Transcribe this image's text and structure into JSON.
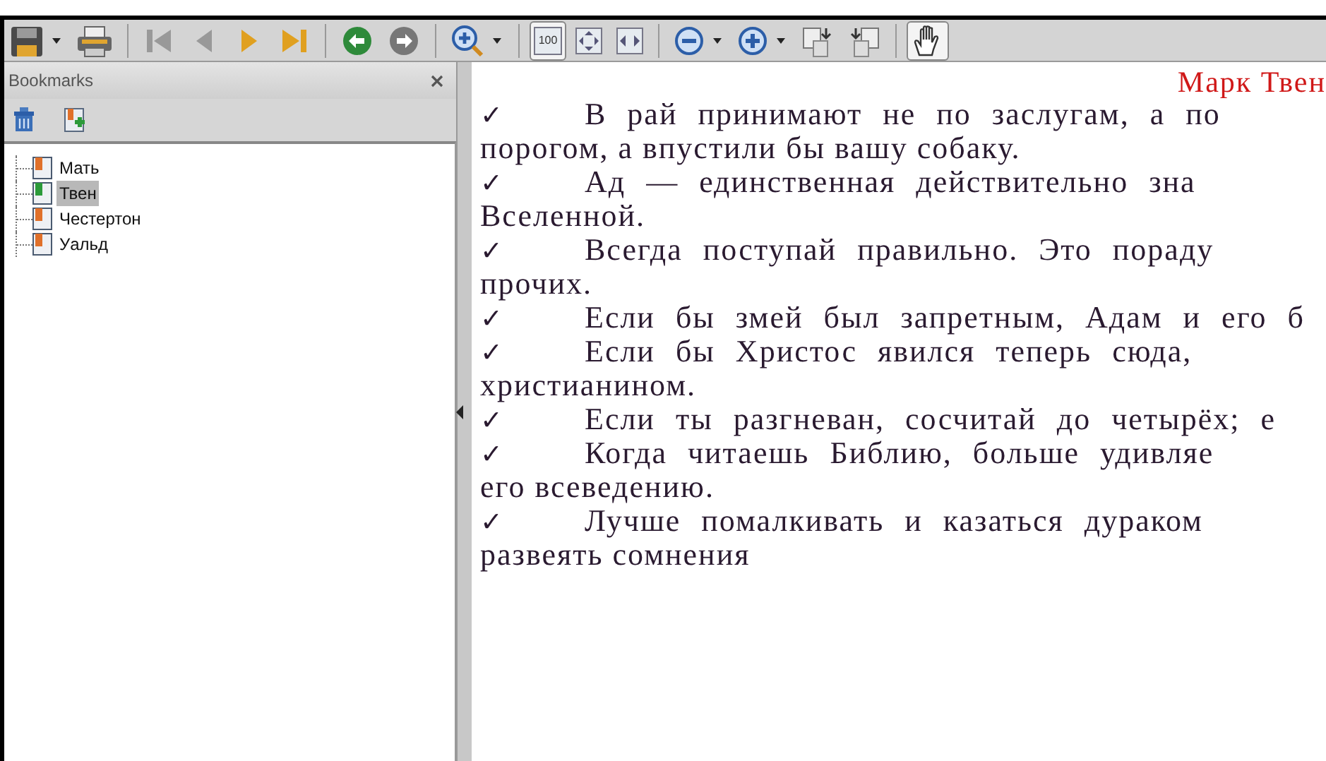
{
  "toolbar": {
    "buttons": [
      {
        "kind": "save",
        "dropdown": true,
        "selected": false
      },
      {
        "kind": "print",
        "dropdown": false,
        "selected": false
      },
      {
        "kind": "sep"
      },
      {
        "kind": "first",
        "dropdown": false,
        "selected": false
      },
      {
        "kind": "prev",
        "dropdown": false,
        "selected": false
      },
      {
        "kind": "next",
        "dropdown": false,
        "selected": false
      },
      {
        "kind": "last",
        "dropdown": false,
        "selected": false
      },
      {
        "kind": "sep"
      },
      {
        "kind": "back",
        "dropdown": false,
        "selected": false
      },
      {
        "kind": "forward",
        "dropdown": false,
        "selected": false
      },
      {
        "kind": "sep"
      },
      {
        "kind": "zoom",
        "dropdown": true,
        "selected": false
      },
      {
        "kind": "sep"
      },
      {
        "kind": "actual",
        "label": "100",
        "dropdown": false,
        "selected": true
      },
      {
        "kind": "fitpage",
        "dropdown": false,
        "selected": false
      },
      {
        "kind": "fitwidth",
        "dropdown": false,
        "selected": false
      },
      {
        "kind": "sep"
      },
      {
        "kind": "zoomout",
        "dropdown": true,
        "selected": false
      },
      {
        "kind": "zoomin",
        "dropdown": true,
        "selected": false
      },
      {
        "kind": "rotcw",
        "dropdown": false,
        "selected": false
      },
      {
        "kind": "rotccw",
        "dropdown": false,
        "selected": false
      },
      {
        "kind": "sep"
      },
      {
        "kind": "hand",
        "dropdown": false,
        "selected": true
      }
    ]
  },
  "sidebar": {
    "title": "Bookmarks",
    "items": [
      {
        "label": "Мать",
        "selected": false
      },
      {
        "label": "Твен",
        "selected": true
      },
      {
        "label": "Честертон",
        "selected": false
      },
      {
        "label": "Уальд",
        "selected": false
      }
    ]
  },
  "document": {
    "heading": "Марк Твен",
    "lines": [
      {
        "text": "В рай принимают не по заслугам, а по",
        "checked": true
      },
      {
        "text": "порогом, а впустили бы вашу собаку.",
        "checked": false
      },
      {
        "text": "Ад — единственная действительно зна",
        "checked": true
      },
      {
        "text": "Вселенной.",
        "checked": false
      },
      {
        "text": "Всегда поступай правильно. Это пораду",
        "checked": true
      },
      {
        "text": "прочих.",
        "checked": false
      },
      {
        "text": "Если бы змей был запретным, Адам и его б",
        "checked": true
      },
      {
        "text": "Если бы Христос явился теперь сюда,",
        "checked": true
      },
      {
        "text": "христианином.",
        "checked": false
      },
      {
        "text": "Если ты разгневан, сосчитай до четырёх; е",
        "checked": true
      },
      {
        "text": "Когда читаешь Библию, больше удивляе",
        "checked": true
      },
      {
        "text": "его всеведению.",
        "checked": false
      },
      {
        "text": "Лучше помалкивать и казаться дураком",
        "checked": true
      },
      {
        "text": "развеять сомнения",
        "checked": false
      }
    ]
  },
  "check_mark": "✓"
}
